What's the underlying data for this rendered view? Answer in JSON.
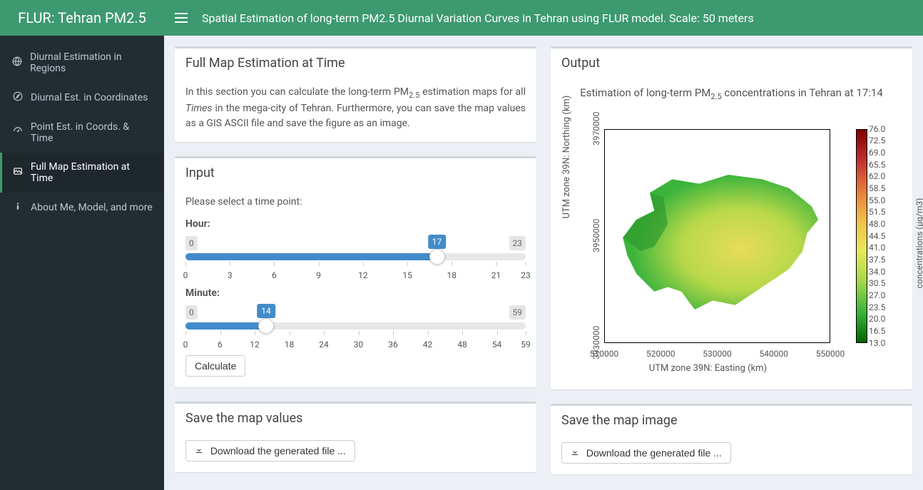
{
  "app": {
    "title": "FLUR: Tehran PM2.5"
  },
  "topbar": {
    "title": "Spatial Estimation of long-term PM2.5 Diurnal Variation Curves in Tehran using FLUR model. Scale: 50 meters"
  },
  "sidebar": {
    "items": [
      {
        "label": "Diurnal Estimation in Regions",
        "icon": "globe"
      },
      {
        "label": "Diurnal Est. in Coordinates",
        "icon": "compass"
      },
      {
        "label": "Point Est. in Coords. & Time",
        "icon": "dashboard"
      },
      {
        "label": "Full Map Estimation at Time",
        "icon": "image"
      },
      {
        "label": "About Me, Model, and more",
        "icon": "info"
      }
    ]
  },
  "panel_fullmap": {
    "title": "Full Map Estimation at Time",
    "body_pre": "In this section you can calculate the long-term PM",
    "body_sub": "2.5",
    "body_mid": " estimation maps for all ",
    "body_em": "Times",
    "body_post": " in the mega-city of Tehran. Furthermore, you can save the map values as a GIS ASCII file and save the figure as an image."
  },
  "panel_input": {
    "title": "Input",
    "prompt": "Please select a time point:",
    "hour_label": "Hour:",
    "hour": {
      "min": 0,
      "max": 23,
      "value": 17,
      "ticks": [
        0,
        3,
        6,
        9,
        12,
        15,
        18,
        21,
        23
      ]
    },
    "minute_label": "Minute:",
    "minute": {
      "min": 0,
      "max": 59,
      "value": 14,
      "ticks": [
        0,
        6,
        12,
        18,
        24,
        30,
        36,
        42,
        48,
        54,
        59
      ]
    },
    "calculate_label": "Calculate"
  },
  "panel_output": {
    "title": "Output",
    "chart_title_pre": "Estimation of long-term PM",
    "chart_title_sub": "2.5",
    "chart_title_post": " concentrations in Tehran at 17:14",
    "xlabel": "UTM zone 39N: Easting (km)",
    "ylabel": "UTM zone 39N: Northing (km)",
    "cblabel": "concentrations (µg/m3)",
    "x_ticks": [
      "510000",
      "520000",
      "530000",
      "540000",
      "550000"
    ],
    "y_ticks": [
      "3930000",
      "3950000",
      "3970000"
    ],
    "cb_ticks": [
      "76.0",
      "72.5",
      "69.0",
      "65.5",
      "62.0",
      "58.5",
      "55.0",
      "51.5",
      "48.0",
      "44.5",
      "41.0",
      "37.5",
      "34.0",
      "30.5",
      "27.0",
      "23.5",
      "20.0",
      "16.5",
      "13.0"
    ]
  },
  "panel_save_values": {
    "title": "Save the map values",
    "btn": "Download the generated file ..."
  },
  "panel_save_image": {
    "title": "Save the map image",
    "btn": "Download the generated file ..."
  },
  "chart_data": {
    "type": "heatmap",
    "title": "Estimation of long-term PM2.5 concentrations in Tehran at 17:14",
    "xlabel": "UTM zone 39N: Easting (km)",
    "ylabel": "UTM zone 39N: Northing (km)",
    "xlim": [
      505000,
      558000
    ],
    "ylim": [
      3925000,
      3975000
    ],
    "colorbar": {
      "label": "concentrations (µg/m3)",
      "min": 13.0,
      "max": 76.0,
      "step": 3.5,
      "colormap": "green-yellow-red"
    },
    "note": "Raster map of Tehran city boundary; values visually range roughly 15–45 µg/m3 across the region with higher (yellow) values in the central-east and lower (green) in the west/northwest."
  }
}
